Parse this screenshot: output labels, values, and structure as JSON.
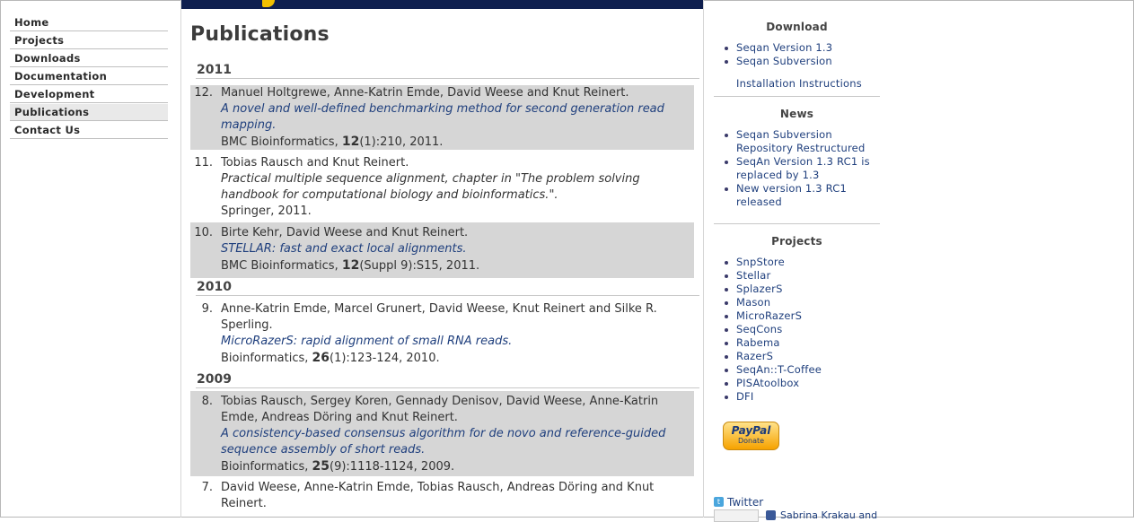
{
  "nav": {
    "items": [
      {
        "label": "Home"
      },
      {
        "label": "Projects"
      },
      {
        "label": "Downloads"
      },
      {
        "label": "Documentation"
      },
      {
        "label": "Development"
      },
      {
        "label": "Publications",
        "active": true
      },
      {
        "label": "Contact Us"
      }
    ]
  },
  "main": {
    "title": "Publications",
    "years": [
      "2011",
      "2010",
      "2009"
    ],
    "pubs": [
      {
        "num": "12.",
        "authors": "Manuel Holtgrewe, Anne-Katrin Emde, David Weese and Knut Reinert.",
        "title": "A novel and well-defined benchmarking method for second generation read mapping.",
        "venue_pre": "BMC Bioinformatics, ",
        "vol": "12",
        "venue_post": "(1):210, 2011."
      },
      {
        "num": "11.",
        "authors": "Tobias Rausch and Knut Reinert.",
        "title": "Practical multiple sequence alignment, chapter in \"The problem solving handbook for computational biology and bioinformatics.\".",
        "venue": "Springer, 2011."
      },
      {
        "num": "10.",
        "authors": "Birte Kehr, David Weese and Knut Reinert.",
        "title": "STELLAR: fast and exact local alignments.",
        "venue_pre": "BMC Bioinformatics, ",
        "vol": "12",
        "venue_post": "(Suppl 9):S15, 2011."
      },
      {
        "num": "9.",
        "authors": "Anne-Katrin Emde, Marcel Grunert, David Weese, Knut Reinert and Silke R. Sperling.",
        "title": "MicroRazerS: rapid alignment of small RNA reads.",
        "venue_pre": "Bioinformatics, ",
        "vol": "26",
        "venue_post": "(1):123-124, 2010."
      },
      {
        "num": "8.",
        "authors": "Tobias Rausch, Sergey Koren, Gennady Denisov, David Weese, Anne-Katrin Emde, Andreas Döring and Knut Reinert.",
        "title": "A consistency-based consensus algorithm for de novo and reference-guided sequence assembly of short reads.",
        "venue_pre": "Bioinformatics, ",
        "vol": "25",
        "venue_post": "(9):1118-1124, 2009."
      },
      {
        "num": "7.",
        "authors": "David Weese, Anne-Katrin Emde, Tobias Rausch, Andreas Döring and Knut Reinert."
      }
    ]
  },
  "sidebar": {
    "download": {
      "title": "Download",
      "items": [
        "Seqan Version 1.3",
        "Seqan Subversion"
      ],
      "install": "Installation Instructions"
    },
    "news": {
      "title": "News",
      "items": [
        "Seqan Subversion Repository Restructured",
        "SeqAn Version 1.3 RC1 is replaced by 1.3",
        "New version 1.3 RC1 released"
      ]
    },
    "projects": {
      "title": "Projects",
      "items": [
        "SnpStore",
        "Stellar",
        "SplazerS",
        "Mason",
        "MicroRazerS",
        "SeqCons",
        "Rabema",
        "RazerS",
        "SeqAn::T-Coffee",
        "PISAtoolbox",
        "DFI"
      ]
    },
    "paypal": {
      "brand": "PayPal",
      "label": "Donate"
    },
    "twitter": "Twitter",
    "facebook": "Sabrina Krakau and"
  },
  "colors": {
    "link": "#1f3f7d",
    "shade": "#d6d6d6",
    "banner": "#0f1f4f"
  }
}
